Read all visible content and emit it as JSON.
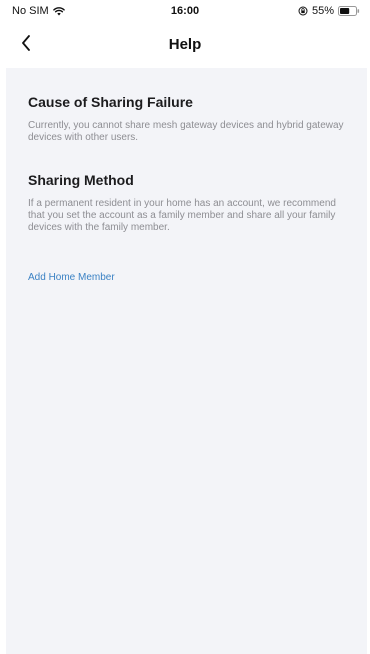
{
  "status_bar": {
    "carrier": "No SIM",
    "time": "16:00",
    "battery_percent": "55%",
    "icons": [
      "wifi-icon",
      "lock-rotation-icon",
      "battery-icon"
    ]
  },
  "nav": {
    "title": "Help",
    "back_icon": "chevron-left-icon"
  },
  "content": {
    "sections": [
      {
        "title": "Cause of Sharing Failure",
        "body": "Currently, you cannot share mesh gateway devices and hybrid gateway devices with other users."
      },
      {
        "title": "Sharing Method",
        "body": "If a permanent resident in your home has an account, we recommend that you set the account as a family member and share all your family devices with the family member."
      }
    ],
    "link": "Add Home Member"
  },
  "colors": {
    "background": "#f3f4f8",
    "link": "#3b82c4",
    "body_text": "#8e8e93",
    "title_text": "#1c1c1e"
  }
}
